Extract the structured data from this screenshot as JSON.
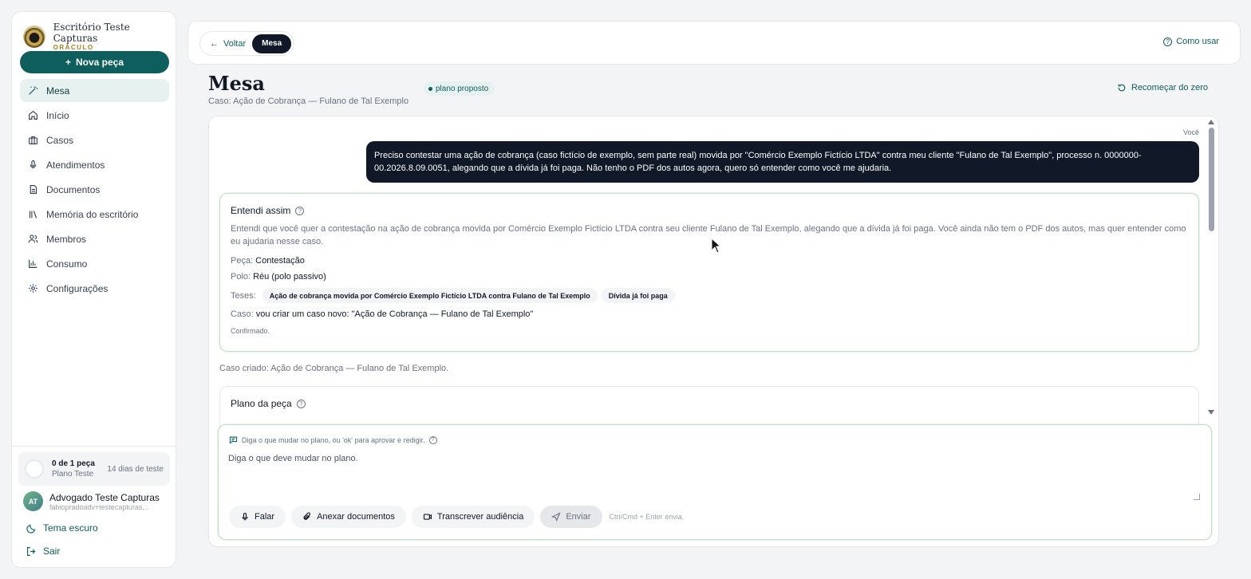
{
  "brand": {
    "name": "Escritório Teste Capturas",
    "sub": "ORÁCULO"
  },
  "sidebar": {
    "new_label": "Nova peça",
    "items": [
      {
        "label": "Mesa",
        "icon": "wand-icon"
      },
      {
        "label": "Início",
        "icon": "home-icon"
      },
      {
        "label": "Casos",
        "icon": "briefcase-icon"
      },
      {
        "label": "Atendimentos",
        "icon": "microphone-icon"
      },
      {
        "label": "Documentos",
        "icon": "document-icon"
      },
      {
        "label": "Memória do escritório",
        "icon": "library-icon"
      },
      {
        "label": "Membros",
        "icon": "users-icon"
      },
      {
        "label": "Consumo",
        "icon": "bar-chart-icon"
      },
      {
        "label": "Configurações",
        "icon": "gear-icon"
      }
    ],
    "usage": {
      "main": "0 de 1 peça",
      "plan": "Plano Teste",
      "days": "14 dias de teste"
    },
    "user": {
      "initials": "AT",
      "name": "Advogado Teste Capturas",
      "email": "fabiopradoadv+testecapturas..."
    },
    "theme_label": "Tema escuro",
    "logout_label": "Sair"
  },
  "topbar": {
    "back_label": "Voltar",
    "current_label": "Mesa",
    "howto_label": "Como usar"
  },
  "page": {
    "title": "Mesa",
    "case": "Caso: Ação de Cobrança — Fulano de Tal Exemplo",
    "status": "plano proposto",
    "restart_label": "Recomeçar do zero"
  },
  "chat": {
    "you_label": "Você",
    "user_message": "Preciso contestar uma ação de cobrança (caso fictício de exemplo, sem parte real) movida por \"Comércio Exemplo Fictício LTDA\" contra meu cliente \"Fulano de Tal Exemplo\", processo n. 0000000-00.2026.8.09.0051, alegando que a dívida já foi paga. Não tenho o PDF dos autos agora, quero só entender como você me ajudaria.",
    "understood": {
      "title": "Entendi assim",
      "desc": "Entendi que você quer a contestação na ação de cobrança movida por Comércio Exemplo Fictício LTDA contra seu cliente Fulano de Tal Exemplo, alegando que a dívida já foi paga. Você ainda não tem o PDF dos autos, mas quer entender como eu ajudaria nesse caso.",
      "peca_k": "Peça:",
      "peca_v": "Contestação",
      "polo_k": "Polo:",
      "polo_v": "Réu (polo passivo)",
      "teses_k": "Teses:",
      "teses": [
        "Ação de cobrança movida por Comércio Exemplo Fictício LTDA contra Fulano de Tal Exemplo",
        "Dívida já foi paga"
      ],
      "caso_k": "Caso:",
      "caso_v": "vou criar um caso novo: \"Ação de Cobrança — Fulano de Tal Exemplo\"",
      "confirmed": "Confirmado."
    },
    "case_created": "Caso criado: Ação de Cobrança — Fulano de Tal Exemplo.",
    "plan_title": "Plano da peça"
  },
  "composer": {
    "hint": "Diga o que mudar no plano, ou 'ok' para aprovar e redigir.",
    "placeholder": "Diga o que deve mudar no plano.",
    "speak_label": "Falar",
    "attach_label": "Anexar documentos",
    "transcribe_label": "Transcrever audiência",
    "send_label": "Enviar",
    "shortcut": "Ctrl/Cmd + Enter envia."
  }
}
